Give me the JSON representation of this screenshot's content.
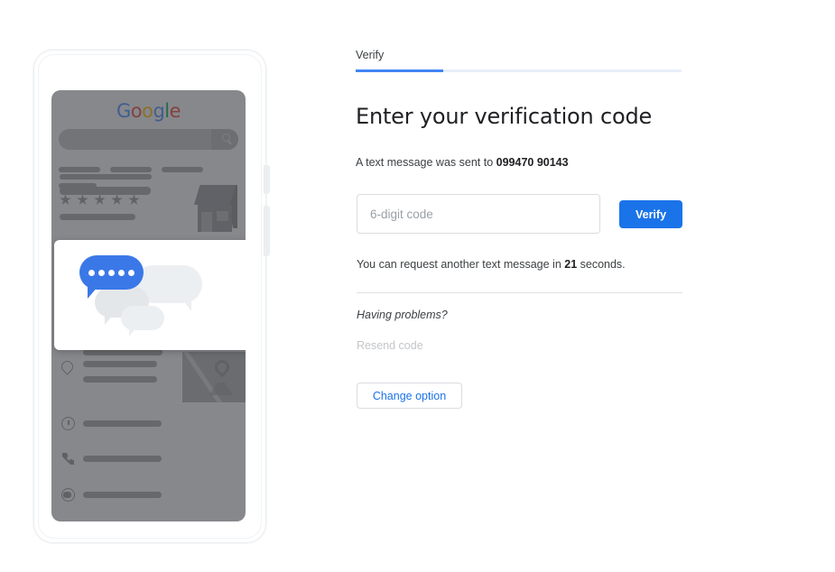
{
  "tab": {
    "label": "Verify",
    "progress_percent": 27,
    "accent_color": "#4285f4",
    "track_color": "#e8eef9"
  },
  "heading": "Enter your verification code",
  "sent_message": {
    "prefix": "A text message was sent to ",
    "phone_number": "099470 90143"
  },
  "code_input": {
    "placeholder": "6-digit code",
    "value": ""
  },
  "verify_button": {
    "label": "Verify",
    "color": "#1a73e8"
  },
  "timer_message": {
    "prefix": "You can request another text message in ",
    "seconds": "21",
    "suffix": " seconds."
  },
  "having_problems_label": "Having problems?",
  "resend_code": {
    "label": "Resend code",
    "disabled": true,
    "color": "#c3c6c9"
  },
  "change_option_button": {
    "label": "Change option",
    "text_color": "#1a73e8"
  },
  "illustration": {
    "device": "android-phone",
    "google_logo": {
      "letters": [
        "G",
        "o",
        "o",
        "g",
        "l",
        "e"
      ],
      "colors": [
        "#4285F4",
        "#DB4437",
        "#F4B400",
        "#4285F4",
        "#0F9D58",
        "#DB4437"
      ]
    },
    "sms_card": {
      "bubble_dots": 5,
      "bubble_color": "#3b78e7"
    },
    "star_rating_count": 5,
    "list_icons": [
      "location-pin-icon",
      "clock-icon",
      "phone-icon",
      "globe-icon"
    ]
  }
}
